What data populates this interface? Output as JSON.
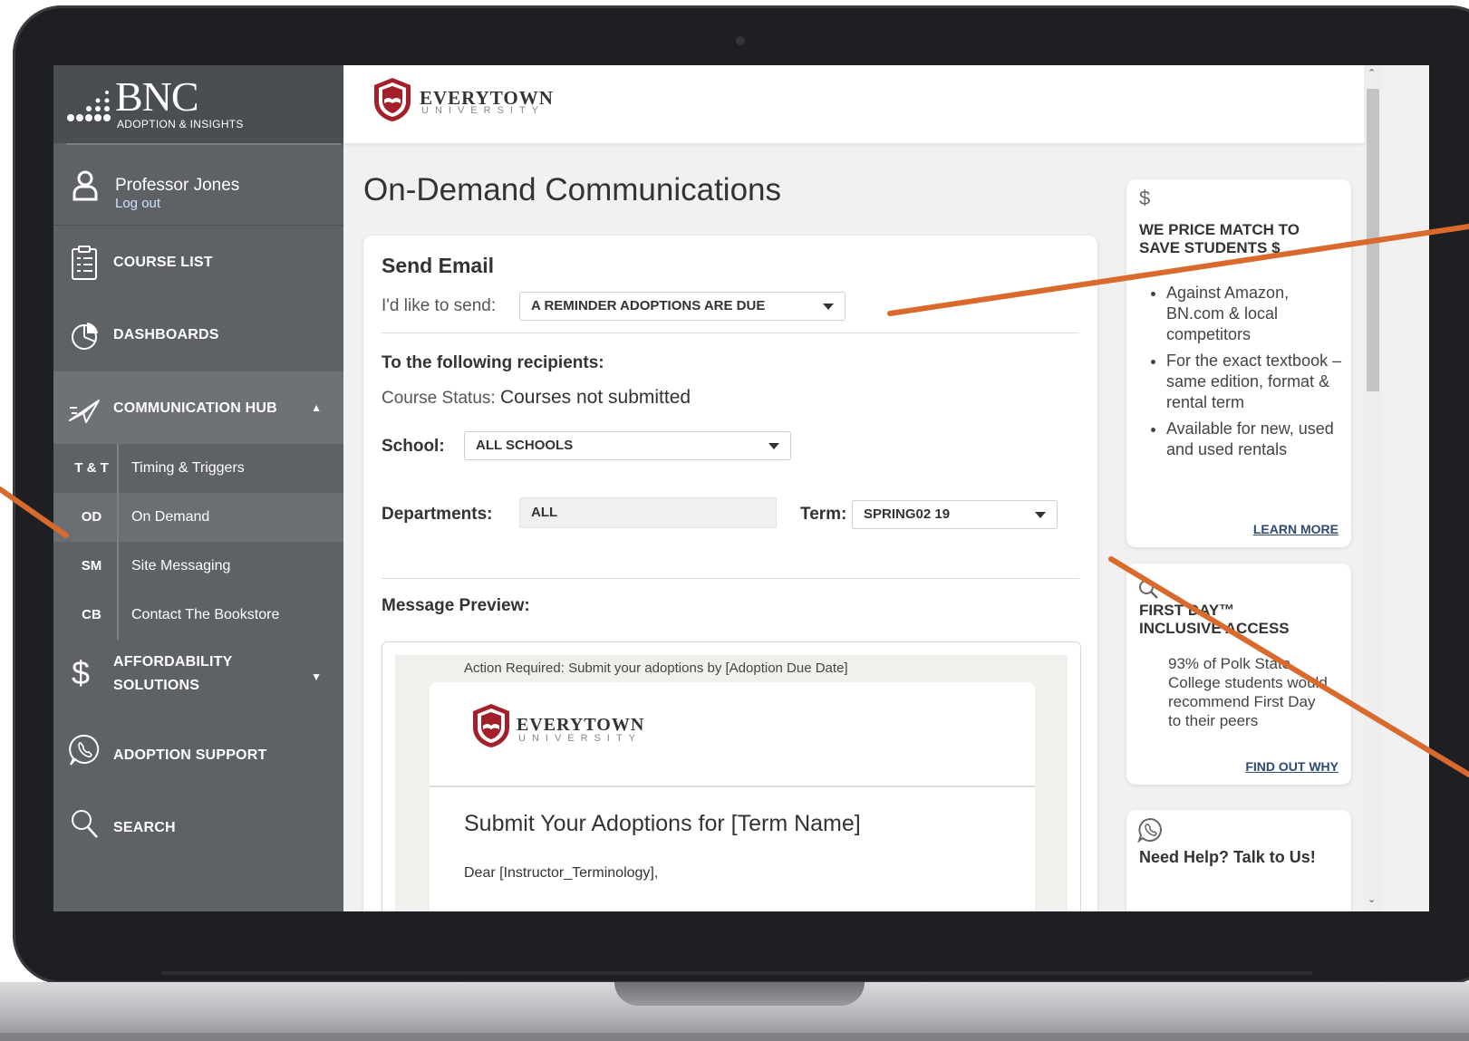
{
  "brand": {
    "bnc_name": "BNC",
    "bnc_subtitle": "ADOPTION & INSIGHTS",
    "university_name": "EVERYTOWN",
    "university_subtitle": "UNIVERSITY",
    "accent_red": "#a3202b",
    "annotation_orange": "#d96a2c"
  },
  "user": {
    "name": "Professor Jones",
    "logout": "Log out"
  },
  "nav": {
    "course_list": "COURSE LIST",
    "dashboards": "DASHBOARDS",
    "communication_hub": "COMMUNICATION HUB",
    "affordability_line1": "AFFORDABILITY",
    "affordability_line2": "SOLUTIONS",
    "adoption_support": "ADOPTION SUPPORT",
    "search": "SEARCH"
  },
  "subnav": [
    {
      "abbr": "T & T",
      "label": "Timing & Triggers"
    },
    {
      "abbr": "OD",
      "label": "On Demand"
    },
    {
      "abbr": "SM",
      "label": "Site Messaging"
    },
    {
      "abbr": "CB",
      "label": "Contact The Bookstore"
    }
  ],
  "page": {
    "title": "On-Demand Communications"
  },
  "form": {
    "heading": "Send Email",
    "send_label": "I'd like to send:",
    "send_value": "A REMINDER ADOPTIONS ARE DUE",
    "recipients_heading": "To the following recipients:",
    "course_status_label": "Course Status:",
    "course_status_value": "Courses not submitted",
    "school_label": "School:",
    "school_value": "ALL SCHOOLS",
    "departments_label": "Departments:",
    "departments_value": "ALL",
    "term_label": "Term:",
    "term_value": "SPRING02 19",
    "preview_heading": "Message Preview:"
  },
  "preview": {
    "subject": "Action Required: Submit your adoptions by [Adoption Due Date]",
    "title": "Submit Your Adoptions for [Term Name]",
    "greeting": "Dear [Instructor_Terminology],"
  },
  "rail": {
    "price_match": {
      "icon": "$",
      "title": "WE PRICE MATCH TO SAVE STUDENTS $",
      "bullets": [
        "Against Amazon, BN.com & local competitors",
        "For the exact textbook – same edition, format & rental term",
        "Available for new, used and used rentals"
      ],
      "link": "LEARN MORE"
    },
    "first_day": {
      "title": "FIRST DAY™ INCLUSIVE ACCESS",
      "body": "93% of Polk State College students would recommend First Day to their peers",
      "link": "FIND OUT WHY"
    },
    "help": {
      "title": "Need Help? Talk to Us!"
    }
  }
}
